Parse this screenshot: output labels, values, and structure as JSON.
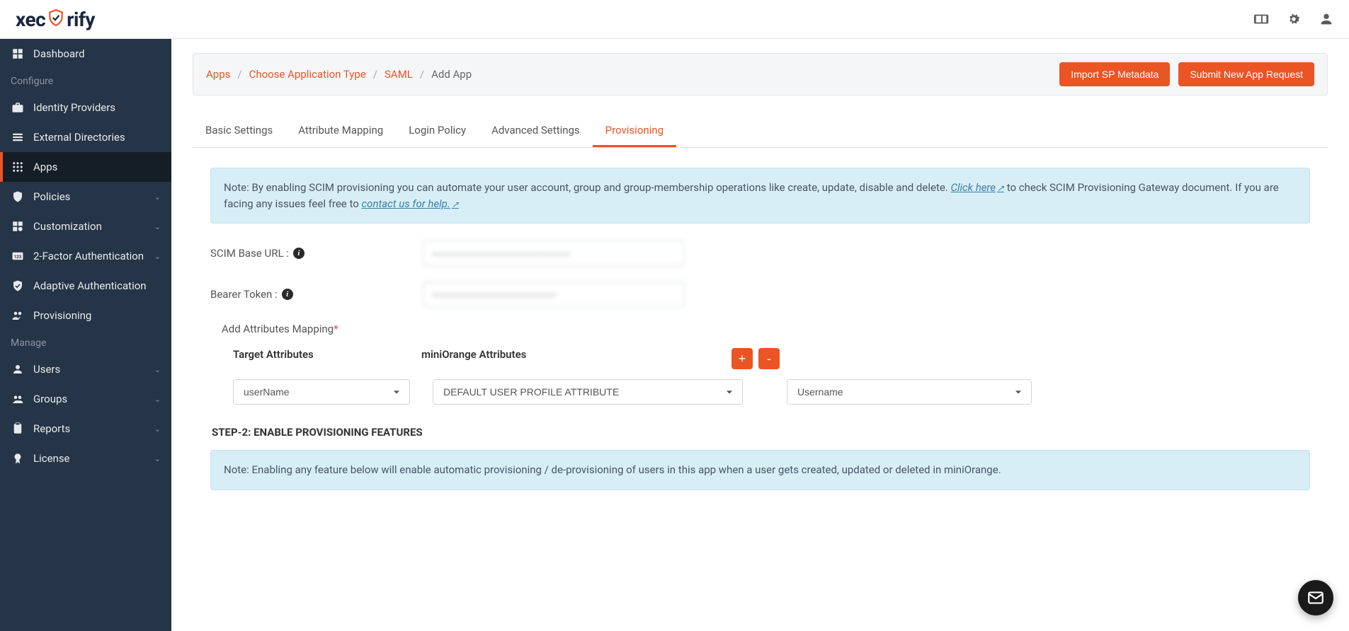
{
  "brand": {
    "name": "xecurify"
  },
  "header_icons": {
    "docs": "docs-icon",
    "settings": "gear-icon",
    "user": "user-icon"
  },
  "sidebar": {
    "items": [
      {
        "label": "Dashboard",
        "icon": "dashboard-icon",
        "expandable": false
      },
      {
        "section": "Configure"
      },
      {
        "label": "Identity Providers",
        "icon": "briefcase-icon",
        "expandable": false
      },
      {
        "label": "External Directories",
        "icon": "list-icon",
        "expandable": false
      },
      {
        "label": "Apps",
        "icon": "grid-icon",
        "expandable": false,
        "active": true
      },
      {
        "label": "Policies",
        "icon": "shield-icon",
        "expandable": true
      },
      {
        "label": "Customization",
        "icon": "puzzle-icon",
        "expandable": true
      },
      {
        "label": "2-Factor Authentication",
        "icon": "numbers-icon",
        "expandable": true
      },
      {
        "label": "Adaptive Authentication",
        "icon": "shield-check-icon",
        "expandable": false
      },
      {
        "label": "Provisioning",
        "icon": "users-sync-icon",
        "expandable": false
      },
      {
        "section": "Manage"
      },
      {
        "label": "Users",
        "icon": "person-icon",
        "expandable": true
      },
      {
        "label": "Groups",
        "icon": "people-icon",
        "expandable": true
      },
      {
        "label": "Reports",
        "icon": "clipboard-icon",
        "expandable": true
      },
      {
        "label": "License",
        "icon": "badge-icon",
        "expandable": true
      }
    ]
  },
  "breadcrumb": {
    "items": [
      "Apps",
      "Choose Application Type",
      "SAML",
      "Add App"
    ],
    "actions": {
      "import": "Import SP Metadata",
      "submit": "Submit New App Request"
    }
  },
  "tabs": [
    "Basic Settings",
    "Attribute Mapping",
    "Login Policy",
    "Advanced Settings",
    "Provisioning"
  ],
  "active_tab": "Provisioning",
  "note1": {
    "prefix": "Note: By enabling SCIM provisioning you can automate your user account, group and group-membership operations like create, update, disable and delete. ",
    "link1": "Click here",
    "mid": " to check SCIM Provisioning Gateway document. If you are facing any issues feel free to ",
    "link2": "contact us for help."
  },
  "form": {
    "scim_label": "SCIM Base URL :",
    "scim_value": "xxxxxxxxxxxxxxxxxxxxxxxxxxxx",
    "bearer_label": "Bearer Token :",
    "bearer_value": "xxxxxxxxxxxxxxxxxxxxxxxxx"
  },
  "attr": {
    "heading": "Add Attributes Mapping",
    "col1": "Target Attributes",
    "col2": "miniOrange Attributes",
    "add": "+",
    "remove": "-",
    "sel1": "userName",
    "sel2": "DEFAULT USER PROFILE ATTRIBUTE",
    "sel3": "Username"
  },
  "step2_heading": "STEP-2: ENABLE PROVISIONING FEATURES",
  "note2": "Note: Enabling any feature below will enable automatic provisioning / de-provisioning of users in this app when a user gets created, updated or deleted in miniOrange."
}
